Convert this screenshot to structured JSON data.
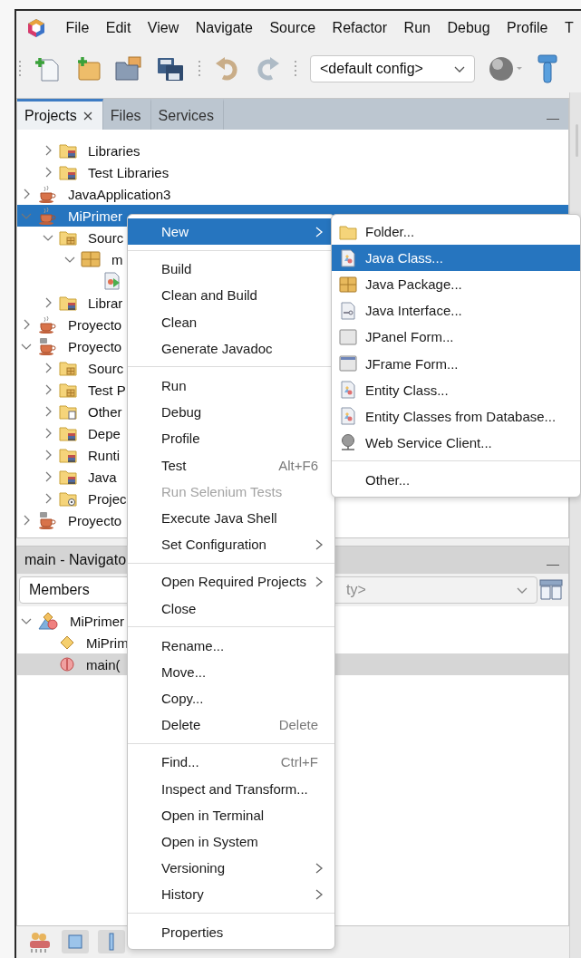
{
  "menu_bar": {
    "items": [
      {
        "label": "File"
      },
      {
        "label": "Edit"
      },
      {
        "label": "View"
      },
      {
        "label": "Navigate"
      },
      {
        "label": "Source"
      },
      {
        "label": "Refactor"
      },
      {
        "label": "Run"
      },
      {
        "label": "Debug"
      },
      {
        "label": "Profile"
      },
      {
        "label": "T"
      }
    ]
  },
  "toolbar": {
    "config": {
      "value": "<default config>"
    }
  },
  "projects_panel": {
    "tabs": [
      {
        "label": "Projects",
        "selected": true,
        "closable": true
      },
      {
        "label": "Files",
        "selected": false,
        "closable": false
      },
      {
        "label": "Services",
        "selected": false,
        "closable": false
      }
    ],
    "tree": [
      {
        "children": [
          {
            "label": "Libraries",
            "kind": "library-folder",
            "expanded": false,
            "selected": false
          },
          {
            "label": "Test Libraries",
            "kind": "library-folder",
            "expanded": false,
            "selected": false
          }
        ]
      },
      {
        "label": "JavaApplication3",
        "kind": "project",
        "expanded": false,
        "selected": false
      },
      {
        "label": "MiPrimer",
        "kind": "project",
        "expanded": true,
        "selected": true,
        "children": [
          {
            "label": "Sourc",
            "kind": "source-folder",
            "expanded": true,
            "selected": false,
            "children": [
              {
                "label": "m",
                "kind": "package",
                "expanded": true,
                "selected": false,
                "children": [
                  {
                    "kind": "main-class",
                    "selected": false
                  }
                ]
              }
            ]
          },
          {
            "label": "Librar",
            "kind": "library-folder",
            "expanded": false,
            "selected": false
          }
        ]
      },
      {
        "label": "Proyecto",
        "kind": "project",
        "expanded": false,
        "selected": false
      },
      {
        "label": "Proyecto",
        "kind": "maven-project",
        "expanded": true,
        "selected": false,
        "children": [
          {
            "label": "Sourc",
            "kind": "source-folder",
            "expanded": false,
            "selected": false
          },
          {
            "label": "Test P",
            "kind": "source-folder",
            "expanded": false,
            "selected": false
          },
          {
            "label": "Other",
            "kind": "other-folder",
            "expanded": false,
            "selected": false
          },
          {
            "label": "Depe",
            "kind": "library-folder",
            "expanded": false,
            "selected": false
          },
          {
            "label": "Runti",
            "kind": "library-folder",
            "expanded": false,
            "selected": false
          },
          {
            "label": "Java",
            "kind": "library-folder",
            "expanded": false,
            "selected": false
          },
          {
            "label": "Projec",
            "kind": "settings-folder",
            "expanded": false,
            "selected": false
          }
        ]
      },
      {
        "label": "Proyecto",
        "kind": "maven-project",
        "expanded": false,
        "selected": false
      }
    ]
  },
  "navigator": {
    "title": "main - Navigato",
    "filter": {
      "value": "Members"
    },
    "scope": {
      "value": "ty>"
    },
    "tree": [
      {
        "label": "MiPrimer",
        "kind": "class",
        "expanded": true,
        "selected": false,
        "children": [
          {
            "label": "MiPrim",
            "kind": "field",
            "selected": false
          },
          {
            "label": "main(",
            "kind": "method",
            "selected": true
          }
        ]
      }
    ]
  },
  "context_menu": {
    "groups": [
      {
        "items": [
          {
            "label": "New",
            "selected": true,
            "disabled": false,
            "submenu": true
          }
        ]
      },
      {
        "items": [
          {
            "label": "Build",
            "selected": false,
            "disabled": false,
            "submenu": false
          },
          {
            "label": "Clean and Build",
            "selected": false,
            "disabled": false,
            "submenu": false
          },
          {
            "label": "Clean",
            "selected": false,
            "disabled": false,
            "submenu": false
          },
          {
            "label": "Generate Javadoc",
            "selected": false,
            "disabled": false,
            "submenu": false
          }
        ]
      },
      {
        "items": [
          {
            "label": "Run",
            "selected": false,
            "disabled": false,
            "submenu": false
          },
          {
            "label": "Debug",
            "selected": false,
            "disabled": false,
            "submenu": false
          },
          {
            "label": "Profile",
            "selected": false,
            "disabled": false,
            "submenu": false
          },
          {
            "label": "Test",
            "shortcut": "Alt+F6",
            "selected": false,
            "disabled": false,
            "submenu": false
          },
          {
            "label": "Run Selenium Tests",
            "selected": false,
            "disabled": true,
            "submenu": false
          },
          {
            "label": "Execute Java Shell",
            "selected": false,
            "disabled": false,
            "submenu": false
          },
          {
            "label": "Set Configuration",
            "selected": false,
            "disabled": false,
            "submenu": true
          }
        ]
      },
      {
        "items": [
          {
            "label": "Open Required Projects",
            "selected": false,
            "disabled": false,
            "submenu": true
          },
          {
            "label": "Close",
            "selected": false,
            "disabled": false,
            "submenu": false
          }
        ]
      },
      {
        "items": [
          {
            "label": "Rename...",
            "selected": false,
            "disabled": false,
            "submenu": false
          },
          {
            "label": "Move...",
            "selected": false,
            "disabled": false,
            "submenu": false
          },
          {
            "label": "Copy...",
            "selected": false,
            "disabled": false,
            "submenu": false
          },
          {
            "label": "Delete",
            "shortcut": "Delete",
            "selected": false,
            "disabled": false,
            "submenu": false
          }
        ]
      },
      {
        "items": [
          {
            "label": "Find...",
            "shortcut": "Ctrl+F",
            "selected": false,
            "disabled": false,
            "submenu": false
          },
          {
            "label": "Inspect and Transform...",
            "selected": false,
            "disabled": false,
            "submenu": false
          },
          {
            "label": "Open in Terminal",
            "selected": false,
            "disabled": false,
            "submenu": false
          },
          {
            "label": "Open in System",
            "selected": false,
            "disabled": false,
            "submenu": false
          },
          {
            "label": "Versioning",
            "selected": false,
            "disabled": false,
            "submenu": true
          },
          {
            "label": "History",
            "selected": false,
            "disabled": false,
            "submenu": true
          }
        ]
      },
      {
        "items": [
          {
            "label": "Properties",
            "selected": false,
            "disabled": false,
            "submenu": false
          }
        ]
      }
    ]
  },
  "new_submenu": {
    "groups": [
      {
        "items": [
          {
            "label": "Folder...",
            "kind": "folder",
            "selected": false
          },
          {
            "label": "Java Class...",
            "kind": "java-class",
            "selected": true
          },
          {
            "label": "Java Package...",
            "kind": "package",
            "selected": false
          },
          {
            "label": "Java Interface...",
            "kind": "java-interface",
            "selected": false
          },
          {
            "label": "JPanel Form...",
            "kind": "panel",
            "selected": false
          },
          {
            "label": "JFrame Form...",
            "kind": "frame",
            "selected": false
          },
          {
            "label": "Entity Class...",
            "kind": "java-class",
            "selected": false
          },
          {
            "label": "Entity Classes from Database...",
            "kind": "java-class",
            "selected": false
          },
          {
            "label": "Web Service Client...",
            "kind": "web-client",
            "selected": false
          }
        ]
      },
      {
        "items": [
          {
            "label": "Other...",
            "selected": false
          }
        ]
      }
    ]
  }
}
